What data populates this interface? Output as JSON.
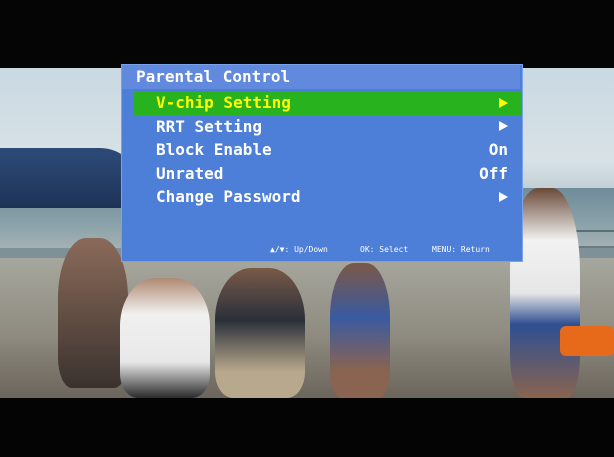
{
  "osd": {
    "title": "Parental Control",
    "items": [
      {
        "label": "V-chip Setting",
        "value": "",
        "has_arrow": true,
        "selected": true
      },
      {
        "label": "RRT Setting",
        "value": "",
        "has_arrow": true,
        "selected": false
      },
      {
        "label": "Block Enable",
        "value": "On",
        "has_arrow": false,
        "selected": false
      },
      {
        "label": "Unrated",
        "value": "Off",
        "has_arrow": false,
        "selected": false
      },
      {
        "label": "Change Password",
        "value": "",
        "has_arrow": true,
        "selected": false
      }
    ],
    "help": {
      "updown": "▲/▼: Up/Down",
      "select": "OK: Select",
      "return": "MENU: Return"
    }
  },
  "colors": {
    "menu_bg": "#4d7fd8",
    "title_bg": "#6189dd",
    "selected_bg": "#28b31e",
    "selected_text": "#ffff00",
    "text": "#ffffff"
  },
  "icons": {
    "item_arrow": "right-triangle-icon"
  }
}
